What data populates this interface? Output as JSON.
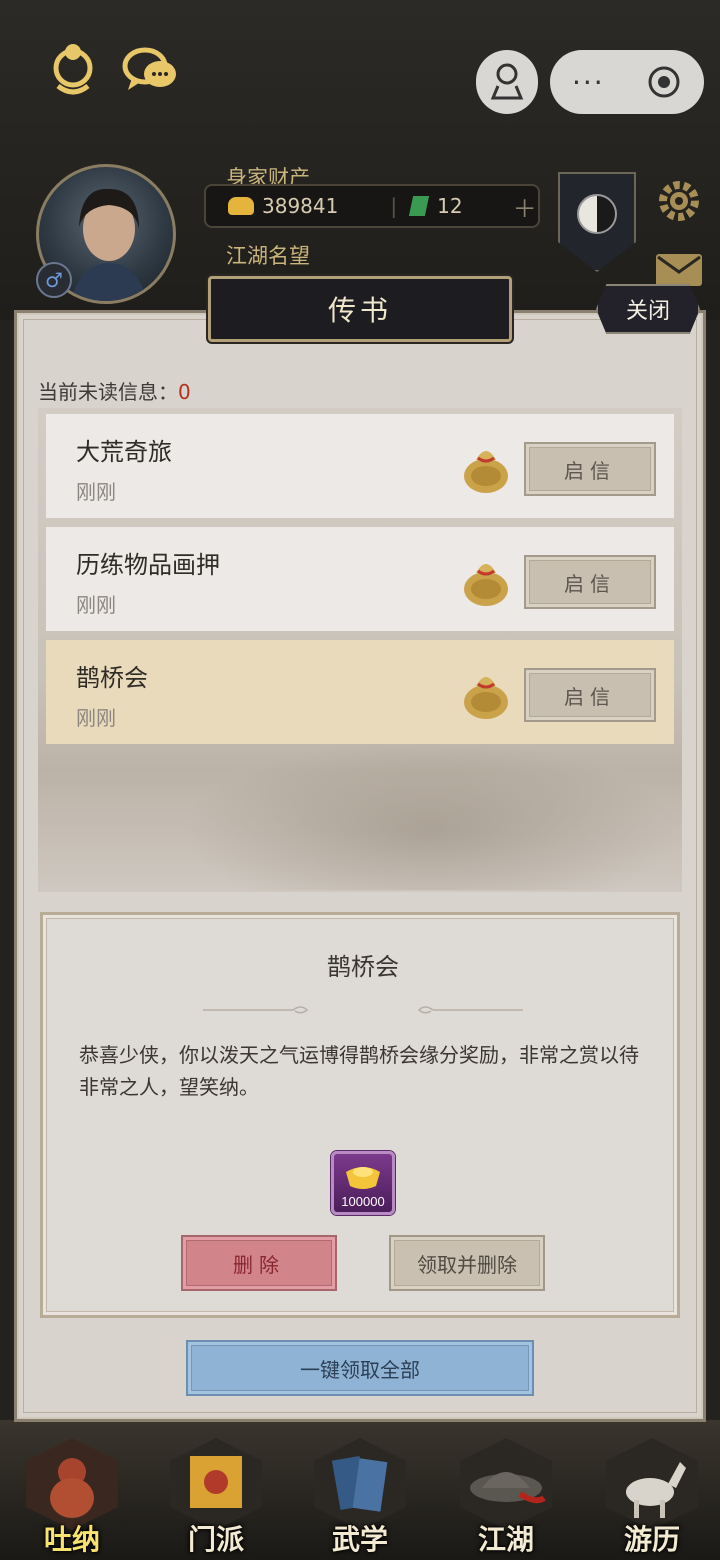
{
  "topbar": {
    "icons": [
      "portrait-icon",
      "chat-icon"
    ],
    "capsule": {
      "more_label": "···"
    }
  },
  "hud": {
    "wealth_label": "身家财产",
    "gold_value": "389841",
    "jade_value": "12",
    "reputation_label": "江湖名望"
  },
  "modal": {
    "title": "传书",
    "close_label": "关闭",
    "unread_label": "当前未读信息：",
    "unread_count": "0",
    "messages": [
      {
        "title": "大荒奇旅",
        "time": "刚刚",
        "button": "启信"
      },
      {
        "title": "历练物品画押",
        "time": "刚刚",
        "button": "启信"
      },
      {
        "title": "鹊桥会",
        "time": "刚刚",
        "button": "启信"
      }
    ],
    "detail": {
      "title": "鹊桥会",
      "body": "恭喜少侠，你以泼天之气运博得鹊桥会缘分奖励，非常之赏以待非常之人，望笑纳。",
      "reward_qty": "100000",
      "delete_label": "删除",
      "claim_delete_label": "领取并删除"
    },
    "claim_all_label": "一键领取全部"
  },
  "bottom_nav": [
    {
      "label": "吐纳",
      "active": true
    },
    {
      "label": "门派"
    },
    {
      "label": "武学"
    },
    {
      "label": "江湖"
    },
    {
      "label": "游历"
    }
  ],
  "colors": {
    "unread_count": "#b3301f",
    "selected_row": "#e8dabb",
    "delete_button": "#d2848b",
    "claim_all_button": "#8fb3d5",
    "reward_tile": "#6a2d7a"
  }
}
